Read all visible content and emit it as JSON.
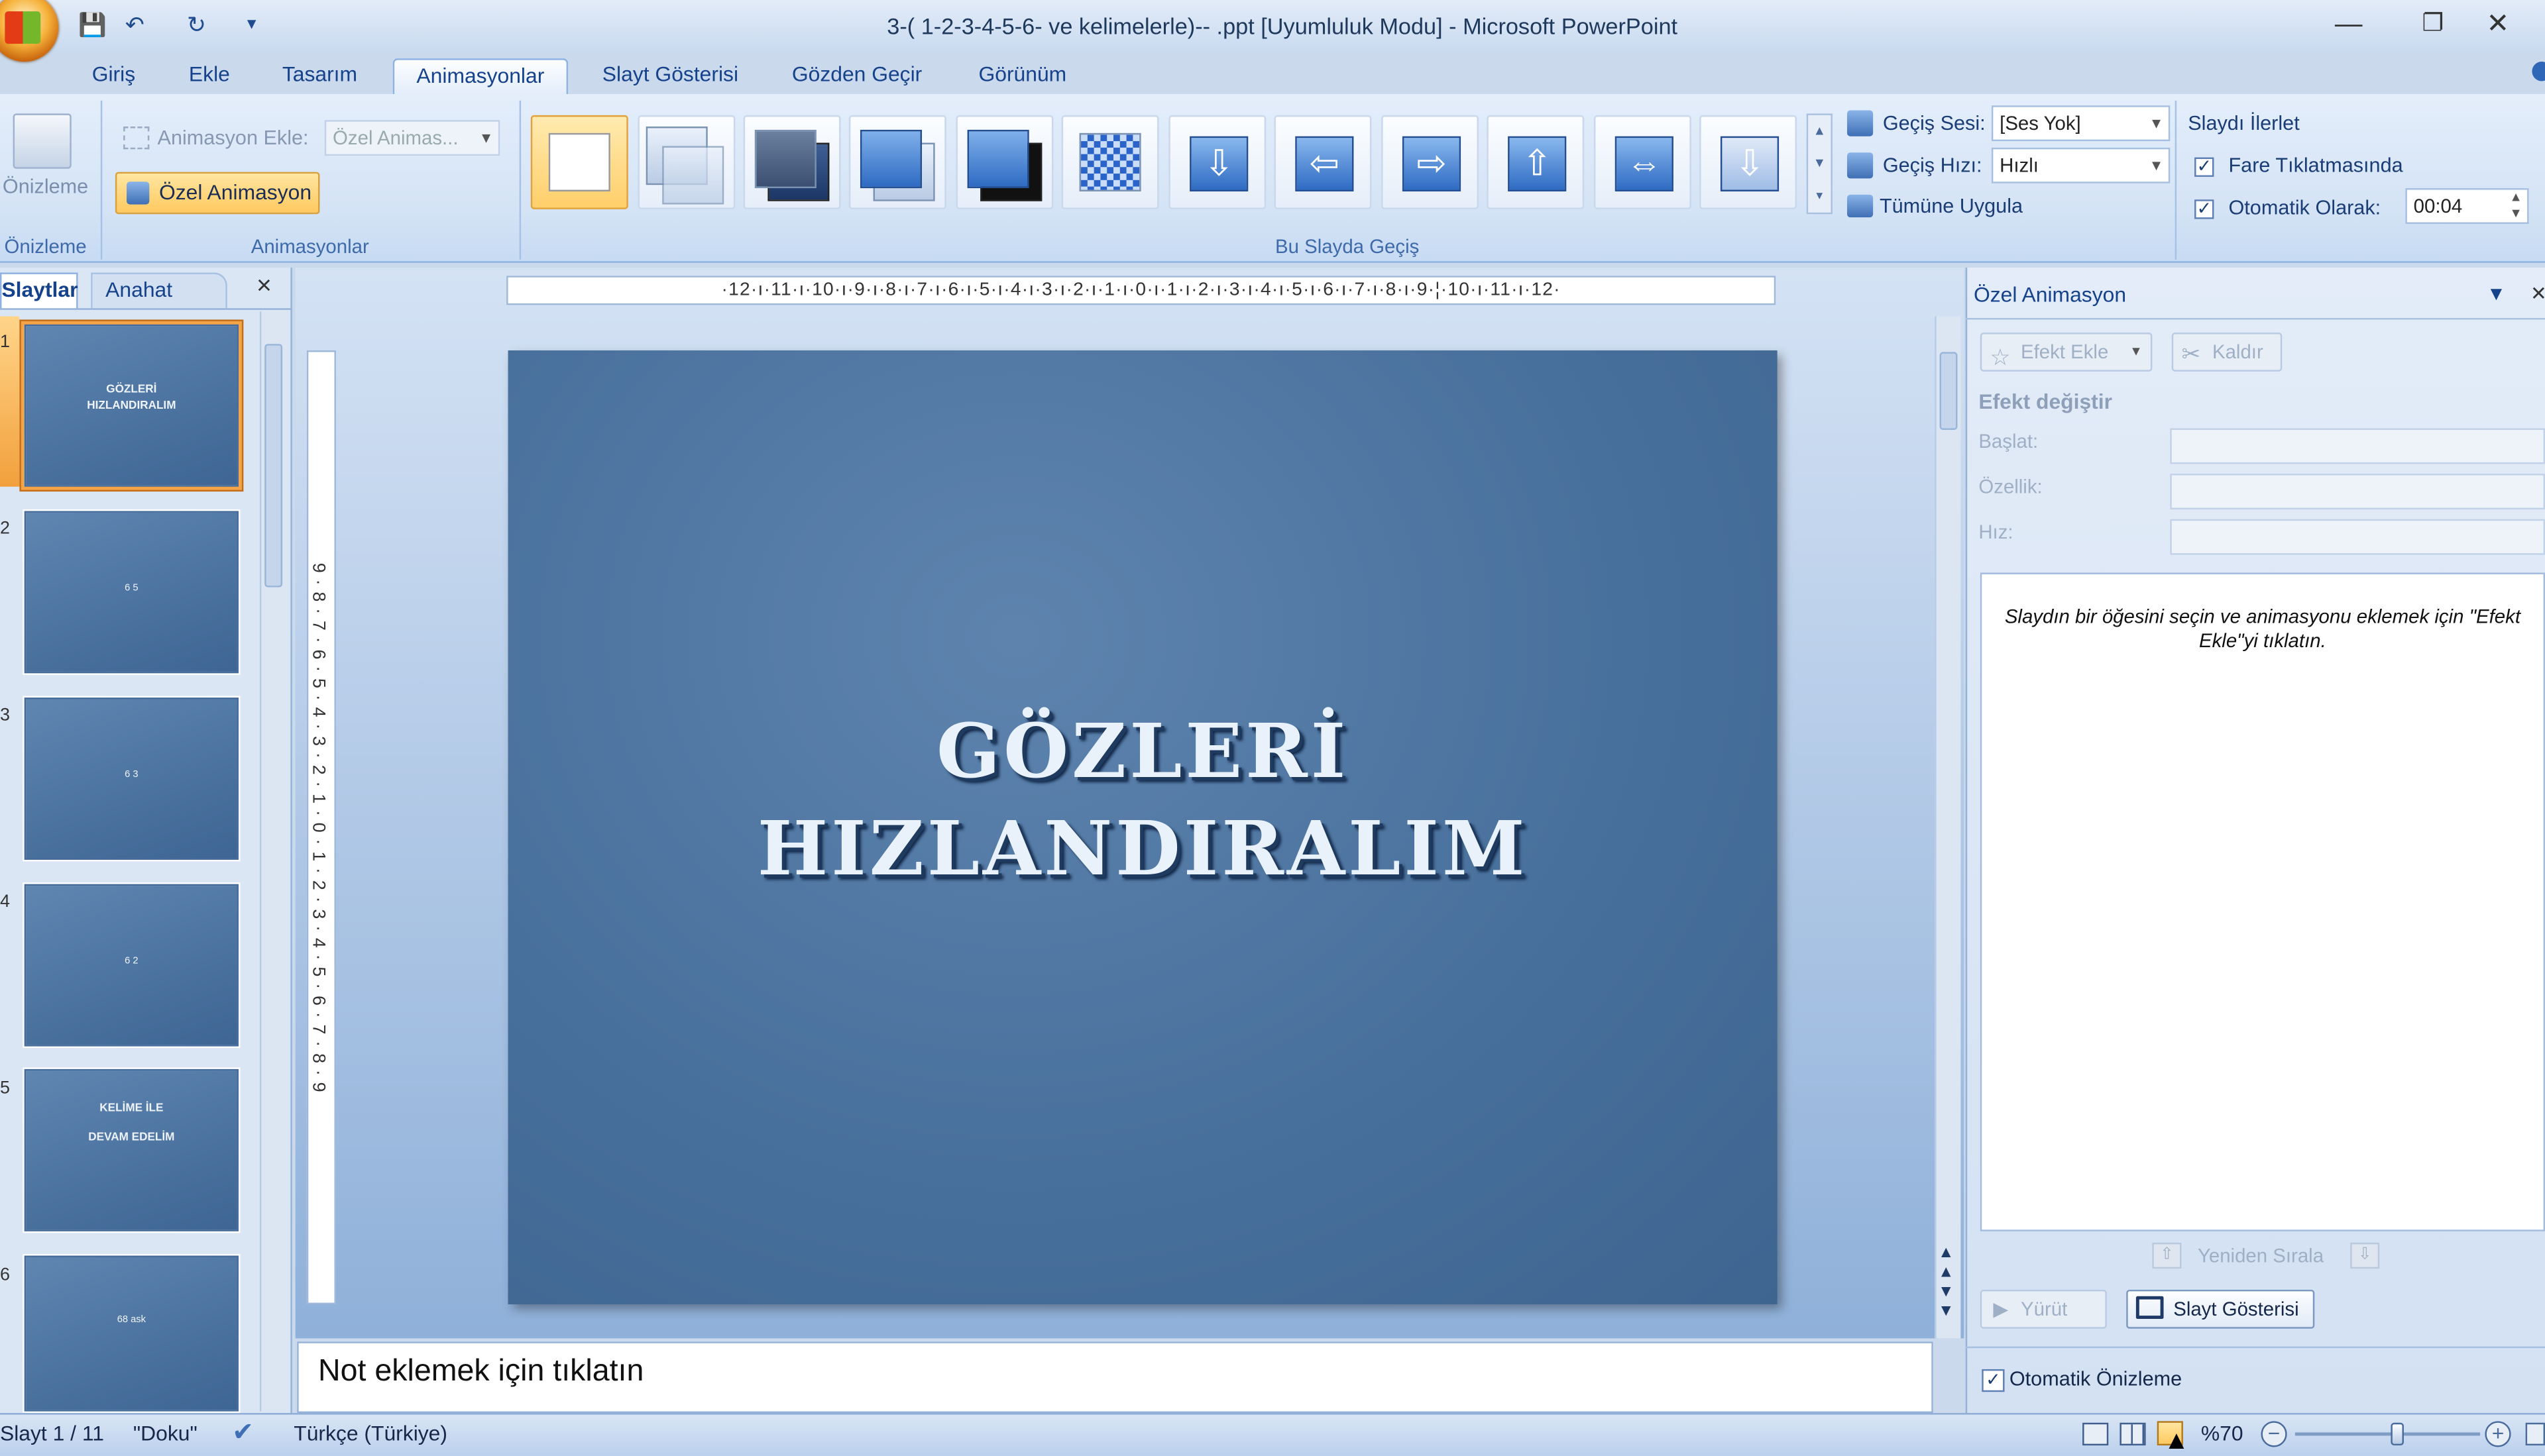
{
  "window": {
    "title": "3-( 1-2-3-4-5-6- ve kelimelerle)-- .ppt [Uyumluluk Modu] - Microsoft PowerPoint",
    "minimize": "—",
    "restore": "❐",
    "close": "✕"
  },
  "qat": {
    "save": "💾",
    "undo": "↶",
    "redo": "↻",
    "more": "▾"
  },
  "tabs": [
    "Giriş",
    "Ekle",
    "Tasarım",
    "Animasyonlar",
    "Slayt Gösterisi",
    "Gözden Geçir",
    "Görünüm"
  ],
  "ribbon": {
    "preview": {
      "label": "Önizleme",
      "group": "Önizleme"
    },
    "animations": {
      "add_label": "Animasyon Ekle:",
      "add_value": "Özel Animas...",
      "custom_button": "Özel Animasyon",
      "group": "Animasyonlar"
    },
    "transition": {
      "group": "Bu Slayda Geçiş",
      "sound_label": "Geçiş Sesi:",
      "sound_value": "[Ses Yok]",
      "speed_label": "Geçiş Hızı:",
      "speed_value": "Hızlı",
      "apply_all": "Tümüne Uygula"
    },
    "advance": {
      "title": "Slaydı İlerlet",
      "on_click_label": "Fare Tıklatmasında",
      "on_click_checked": true,
      "auto_label": "Otomatik Olarak:",
      "auto_checked": true,
      "auto_value": "00:04"
    }
  },
  "left_panel": {
    "tab_slides": "Slaytlar",
    "tab_outline": "Anahat",
    "close": "×",
    "thumbnails": [
      {
        "num": "1",
        "line1": "GÖZLERİ",
        "line2": "HIZLANDIRALIM"
      },
      {
        "num": "2",
        "line1": "6 5",
        "line2": ""
      },
      {
        "num": "3",
        "line1": "6 3",
        "line2": ""
      },
      {
        "num": "4",
        "line1": "6 2",
        "line2": ""
      },
      {
        "num": "5",
        "line1": "KELİME İLE",
        "line2": "DEVAM EDELİM"
      },
      {
        "num": "6",
        "line1": "68 ask",
        "line2": ""
      }
    ]
  },
  "ruler": {
    "horizontal": "·12·ı·11·ı·10·ı·9·ı·8·ı·7·ı·6·ı·5·ı·4·ı·3·ı·2·ı·1·ı·0·ı·1·ı·2·ı·3·ı·4·ı·5·ı·6·ı·7·ı·8·ı·9·¦·10·ı·11·ı·12·",
    "vertical": "9·8·7·6·5·4·3·2·1·0·1·2·3·4·5·6·7·8·9"
  },
  "slide": {
    "title_line1": "GÖZLERİ",
    "title_line2": "HIZLANDIRALIM"
  },
  "notes": {
    "placeholder": "Not eklemek için tıklatın"
  },
  "custom_animation_pane": {
    "title": "Özel Animasyon",
    "add_effect": "Efekt Ekle",
    "remove": "Kaldır",
    "modify": "Efekt değiştir",
    "start_label": "Başlat:",
    "property_label": "Özellik:",
    "speed_label": "Hız:",
    "hint": "Slaydın bir öğesini seçin ve animasyonu eklemek için \"Efekt Ekle\"yi tıklatın.",
    "reorder": "Yeniden Sırala",
    "play": "Yürüt",
    "slideshow": "Slayt Gösterisi",
    "autopreview_label": "Otomatik Önizleme",
    "autopreview_checked": true
  },
  "status": {
    "slide": "Slayt 1 / 11",
    "theme": "\"Doku\"",
    "language": "Türkçe (Türkiye)",
    "zoom": "%70",
    "zoom_level": 0.55
  }
}
